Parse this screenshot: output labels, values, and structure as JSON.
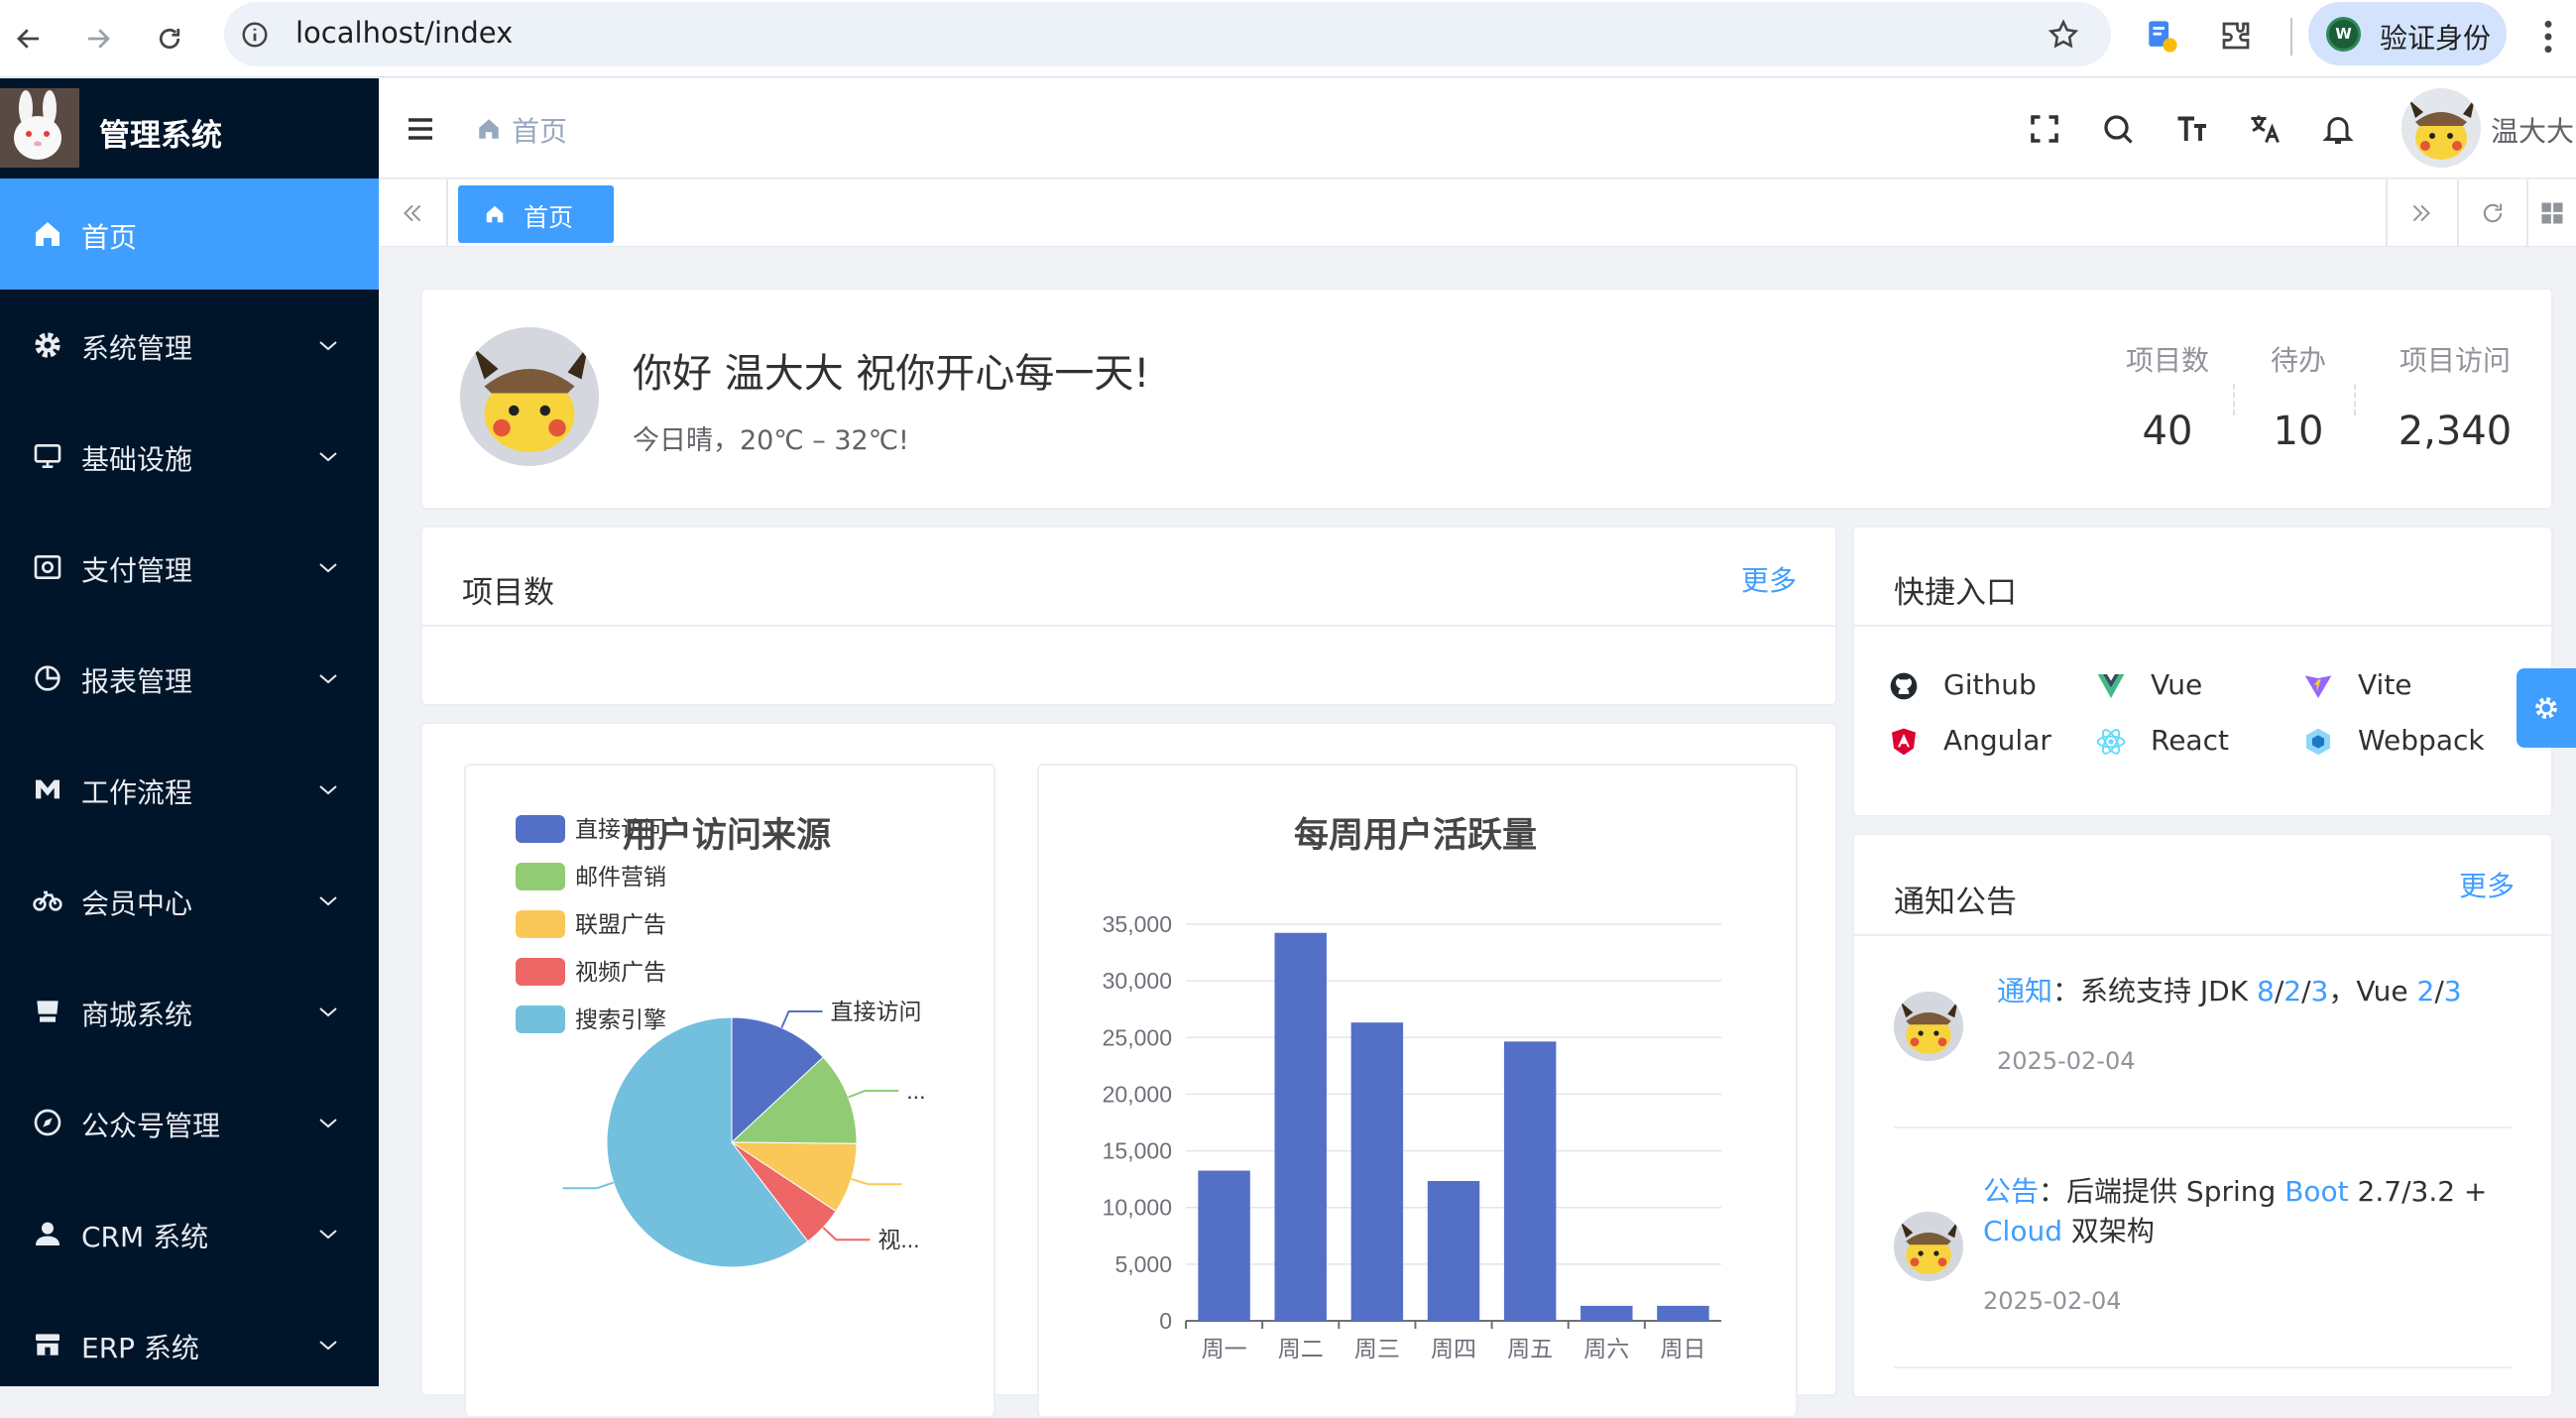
{
  "browser": {
    "url": "localhost/index",
    "verify_label": "验证身份",
    "verify_avatar_letter": "W"
  },
  "sidebar": {
    "title": "管理系统",
    "items": [
      {
        "label": "首页",
        "icon": "home-icon",
        "active": true
      },
      {
        "label": "系统管理",
        "icon": "gear-icon"
      },
      {
        "label": "基础设施",
        "icon": "monitor-icon"
      },
      {
        "label": "支付管理",
        "icon": "payment-icon"
      },
      {
        "label": "报表管理",
        "icon": "pie-chart-icon"
      },
      {
        "label": "工作流程",
        "icon": "workflow-icon"
      },
      {
        "label": "会员中心",
        "icon": "bicycle-icon"
      },
      {
        "label": "商城系统",
        "icon": "shop-icon"
      },
      {
        "label": "公众号管理",
        "icon": "compass-icon"
      },
      {
        "label": "CRM 系统",
        "icon": "user-icon"
      },
      {
        "label": "ERP 系统",
        "icon": "store-icon"
      }
    ]
  },
  "navbar": {
    "breadcrumb": "首页",
    "user_name": "温大大"
  },
  "tags": {
    "active_tag": "首页"
  },
  "welcome": {
    "greeting": "你好 温大大 祝你开心每一天!",
    "weather": "今日晴，20℃ – 32℃!",
    "stats": [
      {
        "label": "项目数",
        "value": "40"
      },
      {
        "label": "待办",
        "value": "10"
      },
      {
        "label": "项目访问",
        "value": "2,340"
      }
    ]
  },
  "projects": {
    "title": "项目数",
    "more": "更多"
  },
  "shortcuts": {
    "title": "快捷入口",
    "items": [
      {
        "label": "Github",
        "icon": "github-icon",
        "color": "#24292e"
      },
      {
        "label": "Vue",
        "icon": "vue-icon",
        "color": "#42b883"
      },
      {
        "label": "Vite",
        "icon": "vite-icon",
        "color": "#9466ff"
      },
      {
        "label": "Angular",
        "icon": "angular-icon",
        "color": "#dd0031"
      },
      {
        "label": "React",
        "icon": "react-icon",
        "color": "#61dafb"
      },
      {
        "label": "Webpack",
        "icon": "webpack-icon",
        "color": "#3b82c4"
      }
    ]
  },
  "notices": {
    "title": "通知公告",
    "more": "更多",
    "items": [
      {
        "segments": [
          {
            "text": "通知",
            "hl": true
          },
          {
            "text": "：系统支持 JDK "
          },
          {
            "text": "8",
            "hl": true
          },
          {
            "text": "/"
          },
          {
            "text": "2",
            "hl": true
          },
          {
            "text": "/"
          },
          {
            "text": "3",
            "hl": true
          },
          {
            "text": "，Vue "
          },
          {
            "text": "2",
            "hl": true
          },
          {
            "text": "/"
          },
          {
            "text": "3",
            "hl": true
          }
        ],
        "date": "2025-02-04"
      },
      {
        "segments": [
          {
            "text": "公告",
            "hl": true
          },
          {
            "text": "：后端提供 Spring "
          },
          {
            "text": "Boot",
            "hl": true
          },
          {
            "text": " 2.7/3.2 + "
          },
          {
            "text": "Cloud",
            "hl": true
          },
          {
            "text": " 双架构"
          }
        ],
        "date": "2025-02-04"
      }
    ]
  },
  "chart_data": [
    {
      "type": "pie",
      "title": "用户访问来源",
      "legend_position": "top-left",
      "categories": [
        "直接访问",
        "邮件营销",
        "联盟广告",
        "视频广告",
        "搜索引擎"
      ],
      "values": [
        335,
        310,
        234,
        135,
        1548
      ],
      "colors": [
        "#5470c6",
        "#91cc75",
        "#fac858",
        "#ee6666",
        "#73c0de"
      ],
      "slice_labels": [
        "直接访问",
        "...",
        "",
        "视...",
        ""
      ],
      "legend_labels": [
        "直接访问",
        "邮件营销",
        "联盟广告",
        "视频广告",
        "搜索引擎"
      ]
    },
    {
      "type": "bar",
      "title": "每周用户活跃量",
      "categories": [
        "周一",
        "周二",
        "周三",
        "周四",
        "周五",
        "周六",
        "周日"
      ],
      "values": [
        13253,
        34235,
        26321,
        12340,
        24643,
        1322,
        1324
      ],
      "ylim": [
        0,
        35000
      ],
      "yticks": [
        "0",
        "5,000",
        "10,000",
        "15,000",
        "20,000",
        "25,000",
        "30,000",
        "35,000"
      ],
      "color": "#5470c6",
      "grid": true
    }
  ]
}
